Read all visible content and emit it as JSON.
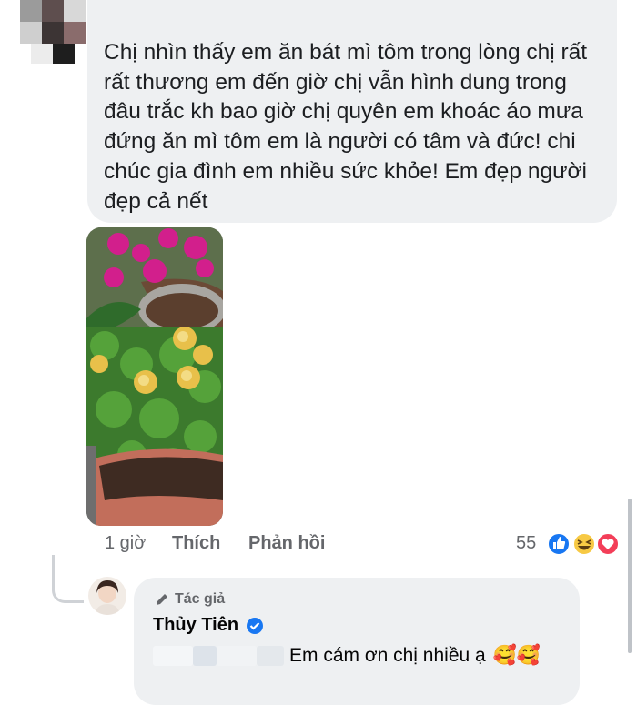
{
  "comment": {
    "text": "Chị nhìn thấy em ăn bát mì tôm trong lòng chị rất\nrất thương em đến giờ chị vẫn hình dung trong\nđâu trắc kh bao giờ chị quyên em khoác áo mưa\nđứng ăn mì tôm em là người có tâm và đức! chi\nchúc gia đình em nhiều sức khỏe! Em đẹp  người\nđẹp  cả nết",
    "time": "1 giờ",
    "like_label": "Thích",
    "reply_label": "Phản hồi",
    "reaction_count": "55",
    "reaction_icons": [
      "like-icon",
      "haha-icon",
      "love-icon"
    ]
  },
  "reply": {
    "author_badge": "Tác giả",
    "author_name": "Thủy Tiên",
    "text": "Em cám ơn chị nhiều ạ",
    "emojis": "🥰🥰"
  },
  "colors": {
    "bubble": "#eef0f2",
    "like_blue": "#1877f2",
    "love_red": "#f33e58",
    "muted_text": "#65676b"
  }
}
